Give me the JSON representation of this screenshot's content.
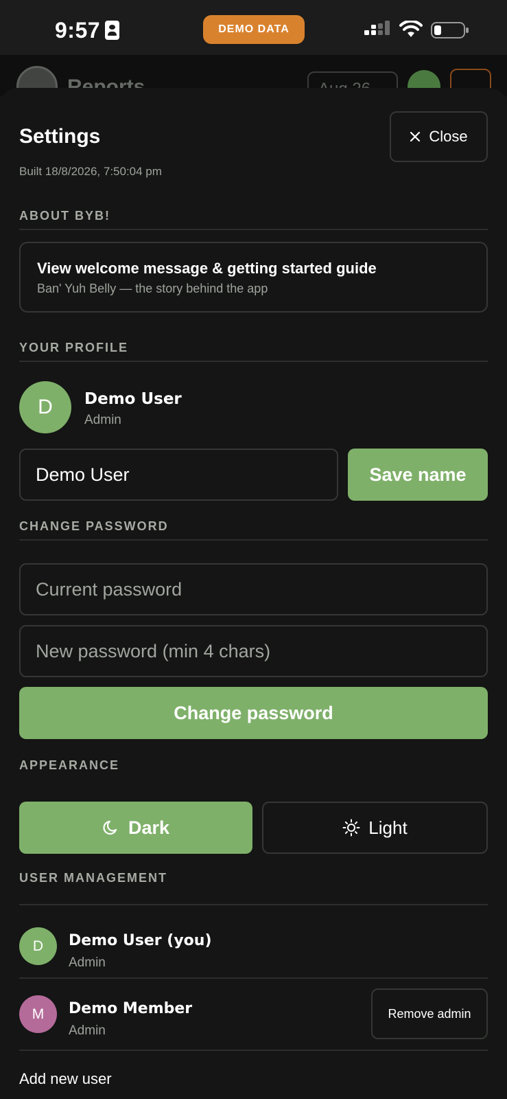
{
  "status_bar": {
    "time": "9:57",
    "demo_badge": "DEMO DATA"
  },
  "background_page": {
    "title": "Reports",
    "date_select": "Aug 26"
  },
  "settings": {
    "title": "Settings",
    "close_label": "Close",
    "build_info": "Built 18/8/2026, 7:50:04 pm",
    "about": {
      "heading": "ABOUT BYB!",
      "welcome_title": "View welcome message & getting started guide",
      "welcome_subtitle": "Ban' Yuh Belly — the story behind the app"
    },
    "profile": {
      "heading": "YOUR PROFILE",
      "avatar_initial": "D",
      "name": "Demo User",
      "role": "Admin",
      "name_input_value": "Demo User",
      "save_label": "Save name"
    },
    "password": {
      "heading": "CHANGE PASSWORD",
      "current_placeholder": "Current password",
      "new_placeholder": "New password (min 4 chars)",
      "submit_label": "Change password"
    },
    "appearance": {
      "heading": "APPEARANCE",
      "dark_label": "Dark",
      "light_label": "Light",
      "selected": "Dark"
    },
    "users": {
      "heading": "USER MANAGEMENT",
      "list": [
        {
          "initial": "D",
          "name": "Demo User (you)",
          "role": "Admin",
          "avatar_color": "#7fb06a"
        },
        {
          "initial": "M",
          "name": "Demo Member",
          "role": "Admin",
          "avatar_color": "#b56b9a",
          "action_label": "Remove admin"
        }
      ],
      "add_label": "Add new user"
    }
  },
  "colors": {
    "accent_green": "#7fb06a",
    "demo_orange": "#d9822e",
    "background": "#141514"
  }
}
